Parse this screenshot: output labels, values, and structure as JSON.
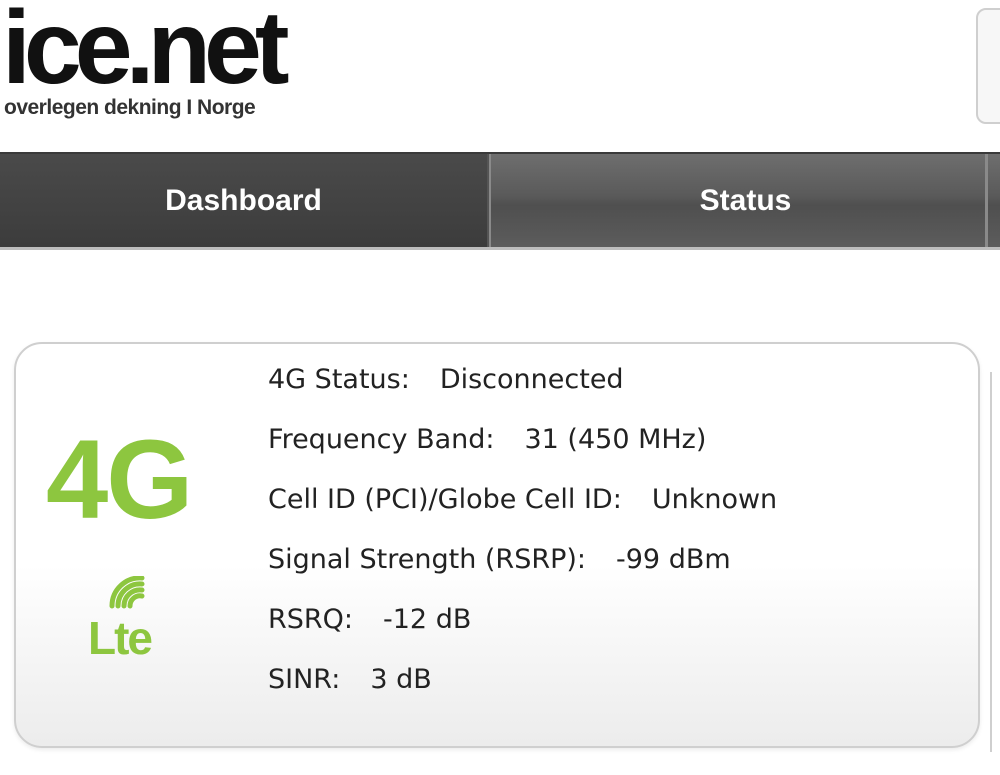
{
  "header": {
    "logo_text": "ice.net",
    "logo_tagline": "overlegen dekning I Norge"
  },
  "nav": {
    "tabs": [
      {
        "label": "Dashboard"
      },
      {
        "label": "Status"
      }
    ]
  },
  "status_card": {
    "icon_4g": "4G",
    "icon_lte": "lte-signal-icon",
    "rows": [
      {
        "label": "4G Status:",
        "value": "Disconnected"
      },
      {
        "label": "Frequency Band:",
        "value": "31 (450 MHz)"
      },
      {
        "label": "Cell ID (PCI)/Globe Cell ID:",
        "value": "Unknown"
      },
      {
        "label": "Signal Strength (RSRP):",
        "value": "-99 dBm"
      },
      {
        "label": "RSRQ:",
        "value": "-12 dB"
      },
      {
        "label": "SINR:",
        "value": "3 dB"
      }
    ]
  },
  "colors": {
    "accent_green": "#8dc63f",
    "nav_dark": "#3c3c3c"
  }
}
